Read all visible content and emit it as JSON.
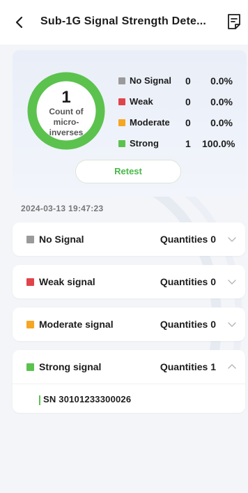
{
  "header": {
    "title": "Sub-1G Signal Strength Dete..."
  },
  "summary": {
    "count": "1",
    "count_caption": "Count of micro-inverses",
    "ring_filled_fraction": 1.0,
    "legend": [
      {
        "name": "No Signal",
        "count": "0",
        "percent": "0.0%",
        "color": "#9a9a9a"
      },
      {
        "name": "Weak",
        "count": "0",
        "percent": "0.0%",
        "color": "#e0444b"
      },
      {
        "name": "Moderate",
        "count": "0",
        "percent": "0.0%",
        "color": "#f5a623"
      },
      {
        "name": "Strong",
        "count": "1",
        "percent": "100.0%",
        "color": "#5bc24e"
      }
    ],
    "retest_label": "Retest"
  },
  "timestamp": "2024-03-13 19:47:23",
  "groups": [
    {
      "name": "No Signal",
      "quantity_label": "Quantities 0",
      "color": "#9a9a9a",
      "expanded": false
    },
    {
      "name": "Weak signal",
      "quantity_label": "Quantities 0",
      "color": "#e0444b",
      "expanded": false
    },
    {
      "name": "Moderate signal",
      "quantity_label": "Quantities 0",
      "color": "#f5a623",
      "expanded": false
    },
    {
      "name": "Strong signal",
      "quantity_label": "Quantities 1",
      "color": "#5bc24e",
      "expanded": true,
      "items": [
        {
          "sn": "SN 30101233300026"
        }
      ]
    }
  ]
}
